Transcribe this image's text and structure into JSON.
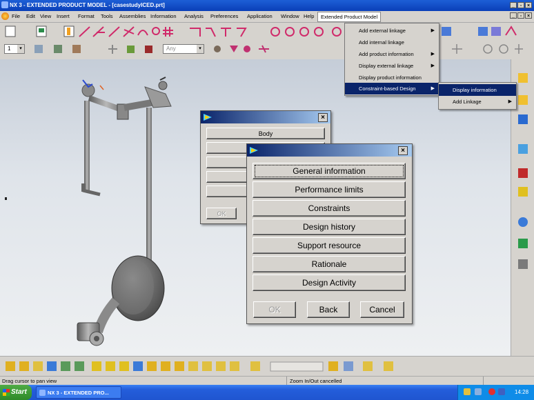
{
  "window": {
    "title": "NX 3 - EXTENDED PRODUCT MODEL - [casestudyICED.prt]"
  },
  "menubar": {
    "items": [
      "File",
      "Edit",
      "View",
      "Insert",
      "Format",
      "Tools",
      "Assemblies",
      "Information",
      "Analysis",
      "Preferences",
      "Application",
      "Window",
      "Help",
      "Extended Product Model"
    ]
  },
  "toolbar2": {
    "layer_value": "1",
    "filter_value": "Any"
  },
  "epm_menu": {
    "items": [
      {
        "label": "Add external linkage",
        "submenu": true
      },
      {
        "label": "Add internal linkage",
        "submenu": false
      },
      {
        "label": "Add product information",
        "submenu": true
      },
      {
        "label": "Display external linkage",
        "submenu": true
      },
      {
        "label": "Display product information",
        "submenu": false
      },
      {
        "label": "Constraint-based Design",
        "submenu": true
      }
    ]
  },
  "cbd_submenu": {
    "items": [
      {
        "label": "Display information",
        "submenu": false
      },
      {
        "label": "Add Linkage",
        "submenu": true
      }
    ]
  },
  "back_dialog": {
    "first_button": "Body",
    "ok_label": "OK"
  },
  "front_dialog": {
    "buttons": [
      "General information",
      "Performance limits",
      "Constraints",
      "Design history",
      "Support resource",
      "Rationale",
      "Design Activity"
    ],
    "ok_label": "OK",
    "back_label": "Back",
    "cancel_label": "Cancel"
  },
  "statusbar": {
    "left": "Drag cursor to pan view",
    "center": "Zoom In/Out cancelled"
  },
  "taskbar": {
    "start_label": "Start",
    "task_label": "NX 3 - EXTENDED PRO...",
    "clock": "14:28"
  },
  "colors": {
    "title_bar": "#0a3fb8",
    "menu_highlight": "#0a246a",
    "dialog_face": "#d6d3ce"
  }
}
